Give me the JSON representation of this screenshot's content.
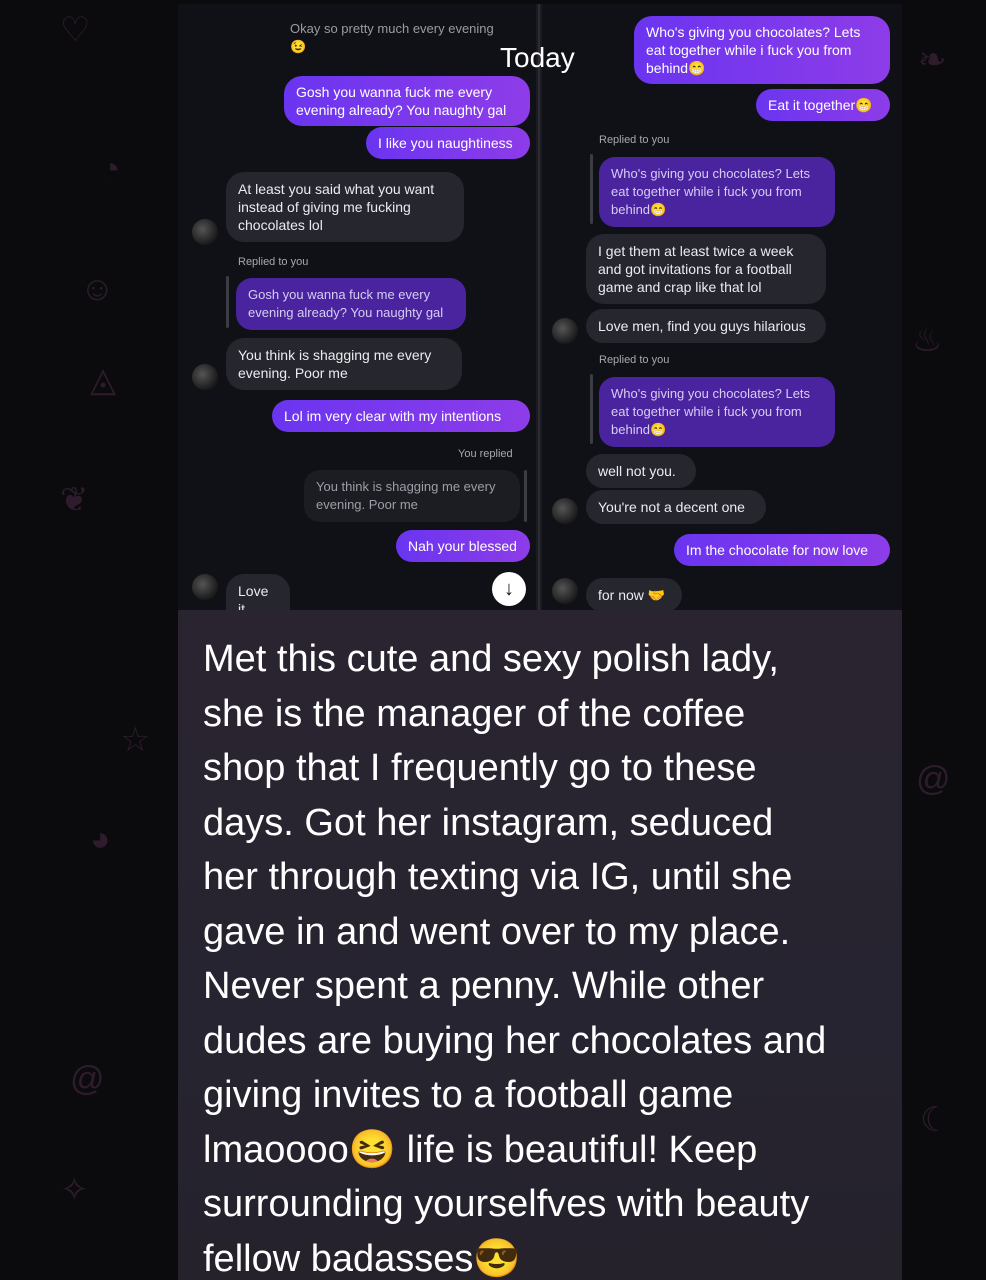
{
  "overlay": {
    "today": "Today"
  },
  "left_pane": {
    "top_quote": "Okay so pretty much every evening",
    "top_quote_emoji": "😉",
    "msg_gosh": "Gosh you wanna fuck me every evening already? You naughty gal",
    "msg_naughtiness": "I like you naughtiness",
    "msg_at_least": "At least you said what you want instead of giving me fucking chocolates lol",
    "replied_to_you": "Replied to you",
    "quote_gosh": "Gosh you wanna fuck me every evening already? You naughty gal",
    "msg_shagging": "You think is shagging me every evening. Poor me",
    "msg_clear": "Lol im very clear with my intentions",
    "you_replied": "You replied",
    "quote_shagging": "You think is shagging me every evening. Poor me",
    "msg_blessed": "Nah your blessed",
    "msg_love_it": "Love it"
  },
  "right_pane": {
    "msg_chocolates": "Who's giving you chocolates? Lets eat together while i fuck you from behind",
    "msg_eat_together": "Eat it together",
    "replied_to_you_1": "Replied to you",
    "quote_chocolates_1": "Who's giving you chocolates? Lets eat together while i fuck you from behind",
    "msg_twice_week": "I get them at least twice a week and got invitations for a football game and crap like that lol",
    "msg_love_men": "Love men, find you guys hilarious",
    "replied_to_you_2": "Replied to you",
    "quote_chocolates_2": "Who's giving you chocolates? Lets eat together while i fuck you from behind",
    "msg_well_not": "well not you.",
    "msg_not_decent": "You're not a decent one",
    "msg_im_chocolate": "Im the chocolate for now love",
    "msg_for_now": "for now",
    "emoji_grin": "😁",
    "emoji_handshake": "🤝"
  },
  "icons": {
    "scroll_down": "↓"
  },
  "caption": {
    "text": "Met this cute and sexy polish lady,\nshe is the manager of the coffee\nshop that I frequently go to these\ndays. Got her instagram, seduced\nher through texting via IG, until she\ngave in and went over to my place.\nNever spent a penny. While other\ndudes are buying her chocolates and\ngiving invites to a football game\nlmaoooo😆 life is beautiful! Keep\nsurrounding yourselfves with beauty\nfellow badasses😎"
  },
  "colors": {
    "outgoing_bubble": "#7a39ee",
    "incoming_bubble": "#26272e",
    "background": "#0b0a0d"
  }
}
